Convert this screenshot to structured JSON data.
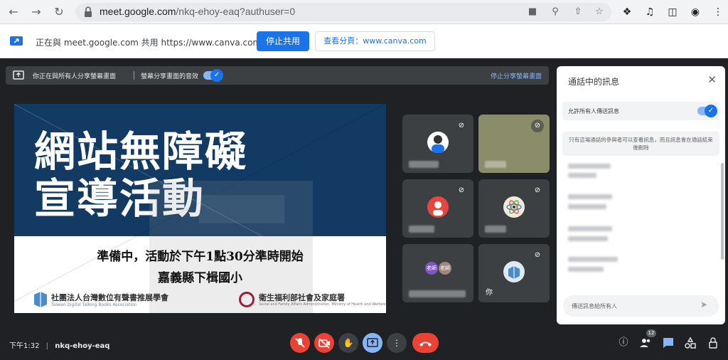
{
  "browser": {
    "url_host": "meet.google.com",
    "url_path": "/nkq-ehoy-eaq?authuser=0"
  },
  "share_bar": {
    "message": "正在與 meet.google.com 共用 https://www.canva.com",
    "stop_label": "停止共用",
    "view_tab_label": "查看分頁：www.canva.com"
  },
  "presenting_bar": {
    "sharing_text": "你正在與所有人分享螢幕畫面",
    "audio_text": "螢幕分享畫面的音效",
    "stop_link": "停止分享螢幕畫面"
  },
  "slide": {
    "title_line1": "網站無障礙",
    "title_line2": "宣導活動",
    "subtitle1": "準備中，活動於下午1點30分準時開始",
    "subtitle2": "嘉義縣下楫國小",
    "org_left": "社團法人台灣數位有聲書推展學會",
    "org_left_en": "Taiwan Digital Talking Books Association",
    "org_right": "衛生福利部社會及家庭署",
    "org_right_en": "Social and Family Affairs Administration, Ministry of Health and Welfare"
  },
  "participants": {
    "tile6_label": "你",
    "tile5_av1": "老師",
    "tile5_av2": "老師"
  },
  "chat": {
    "title": "通話中的訊息",
    "allow_label": "允許所有人傳送訊息",
    "note": "只有這場通話的參與者可以查看訊息，而且訊息會在通話結束後刪除",
    "input_placeholder": "傳送訊息給所有人"
  },
  "bottom": {
    "time": "下午1:32",
    "separator": "|",
    "meeting_code": "nkq-ehoy-eaq",
    "participant_count": "12"
  },
  "colors": {
    "accent": "#1a73e8",
    "danger": "#ea4335",
    "slide_blue": "#123a62"
  }
}
